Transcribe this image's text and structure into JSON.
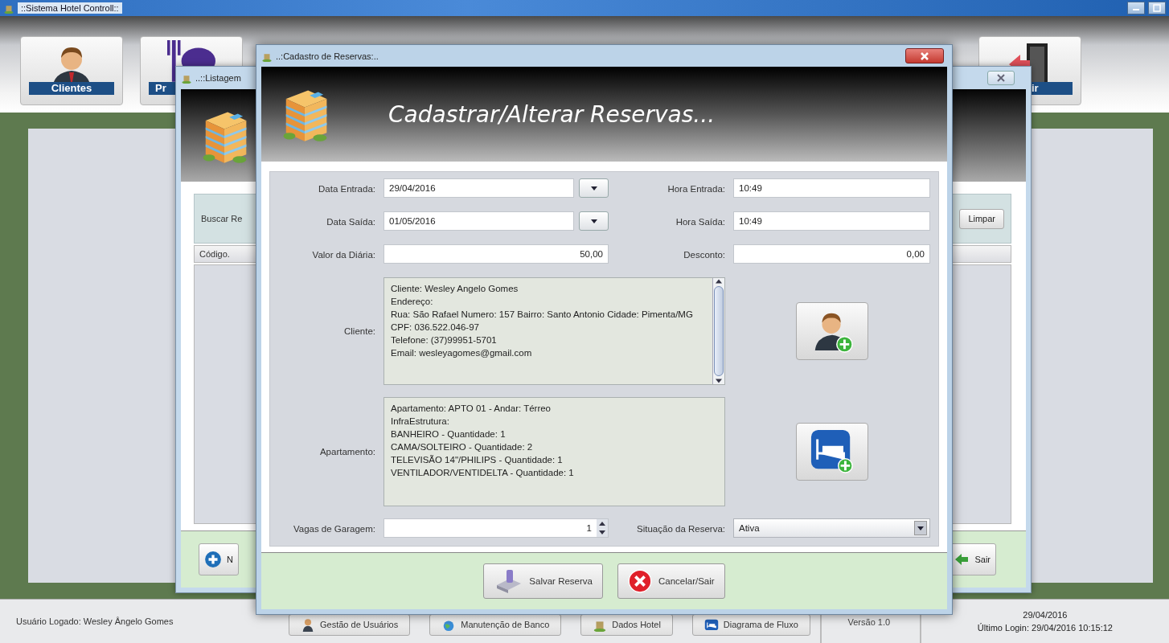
{
  "main_window": {
    "title": "::Sistema Hotel Controll::",
    "toolbar": [
      {
        "label": "Clientes"
      },
      {
        "label": "Pr"
      },
      {
        "label": "ir"
      }
    ]
  },
  "listing_window": {
    "title": "..::Listagem",
    "search_label": "Buscar Re",
    "clear_button": "Limpar",
    "columns": [
      "Código."
    ],
    "new_button": "N",
    "exit_button": "Sair"
  },
  "dialog": {
    "title": "..:Cadastro de Reservas:..",
    "heading": "Cadastrar/Alterar Reservas...",
    "fields": [
      {
        "label": "Data Entrada:",
        "value": "29/04/2016",
        "kind": "date"
      },
      {
        "label": "Hora Entrada:",
        "value": "10:49",
        "kind": "text"
      },
      {
        "label": "Data Saída:",
        "value": "01/05/2016",
        "kind": "date"
      },
      {
        "label": "Hora Saída:",
        "value": "10:49",
        "kind": "text"
      },
      {
        "label": "Valor da Diária:",
        "value": "50,00",
        "kind": "number"
      },
      {
        "label": "Desconto:",
        "value": "0,00",
        "kind": "number"
      }
    ],
    "client": {
      "label": "Cliente:",
      "lines": [
        "Cliente: Wesley Angelo Gomes",
        "Endereço:",
        "Rua: São Rafael Numero: 157 Bairro: Santo Antonio Cidade: Pimenta/MG",
        "CPF: 036.522.046-97",
        "Telefone: (37)99951-5701",
        "Email: wesleyagomes@gmail.com"
      ]
    },
    "apartment": {
      "label": "Apartamento:",
      "lines": [
        "Apartamento: APTO 01 - Andar: Térreo",
        "InfraEstrutura:",
        "BANHEIRO - Quantidade: 1",
        "CAMA/SOLTEIRO - Quantidade: 2",
        "TELEVISÃO 14\"/PHILIPS - Quantidade: 1",
        "VENTILADOR/VENTIDELTA - Quantidade: 1"
      ]
    },
    "garage": {
      "label": "Vagas de Garagem:",
      "value": "1"
    },
    "reservation_status": {
      "label": "Situação da Reserva:",
      "value": "Ativa"
    },
    "buttons": [
      {
        "label": "Salvar Reserva"
      },
      {
        "label": "Cancelar/Sair"
      }
    ]
  },
  "status_bar": {
    "user": "Usuário Logado: Wesley Ângelo Gomes",
    "buttons": [
      {
        "label": "Gestão de Usuários"
      },
      {
        "label": "Manutenção de Banco"
      },
      {
        "label": "Dados Hotel"
      },
      {
        "label": "Diagrama de Fluxo"
      }
    ],
    "version": "Versão 1.0",
    "date": "29/04/2016",
    "last_login": "Último Login: 29/04/2016 10:15:12"
  }
}
